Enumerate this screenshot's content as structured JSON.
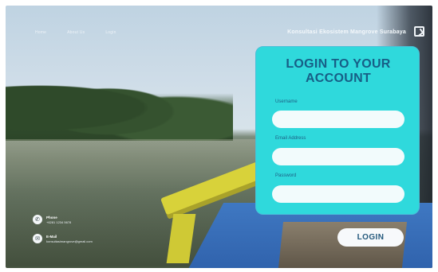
{
  "header": {
    "nav": [
      "Home",
      "About Us",
      "Login"
    ],
    "brand": "Konsultasi Ekosistem Mangrove Surabaya"
  },
  "login": {
    "title_line1": "LOGIN TO YOUR",
    "title_line2": "ACCOUNT",
    "fields": [
      {
        "label": "Username",
        "value": "",
        "placeholder": ""
      },
      {
        "label": "Email Address",
        "value": "",
        "placeholder": ""
      },
      {
        "label": "Password",
        "value": "",
        "placeholder": ""
      }
    ],
    "button_label": "LOGIN"
  },
  "contact": {
    "phone_label": "Phone",
    "phone_value": "+6281 1234 5678",
    "email_label": "E-Mail",
    "email_value": "konsultasimangrove@gmail.com"
  },
  "colors": {
    "card": "#2fd9dc",
    "title": "#175e86",
    "button_bg": "#f7f9fb"
  },
  "icons": {
    "phone": "phone-icon",
    "email": "email-icon",
    "brand": "logo-icon"
  }
}
